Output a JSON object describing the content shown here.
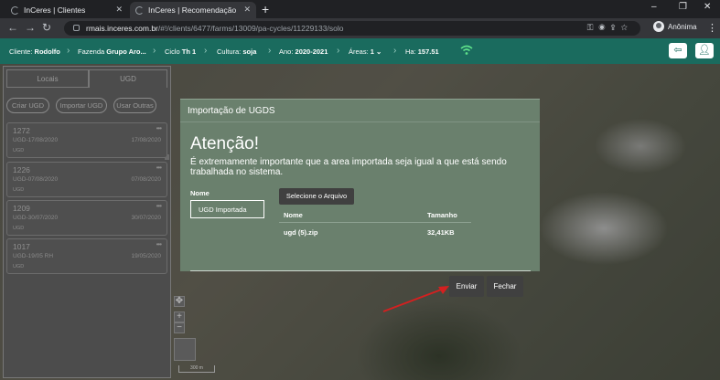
{
  "browser": {
    "tabs": [
      {
        "title": "InCeres | Clientes"
      },
      {
        "title": "InCeres | Recomendação"
      }
    ],
    "new_tab": "+",
    "url_host": "rmais.inceres.com.br",
    "url_path": "/#!/clients/6477/farms/13009/pa-cycles/11229133/solo",
    "profile_name": "Anônima"
  },
  "header": {
    "cliente_label": "Cliente:",
    "cliente_value": "Rodolfo",
    "fazenda_label": "Fazenda",
    "fazenda_value": "Grupo Aro...",
    "ciclo_label": "Ciclo",
    "ciclo_value": "Th 1",
    "cultura_label": "Cultura:",
    "cultura_value": "soja",
    "ano_label": "Ano:",
    "ano_value": "2020-2021",
    "areas_label": "Áreas:",
    "areas_value": "1",
    "ha_label": "Ha:",
    "ha_value": "157.51",
    "accent_color": "#1a6b5e"
  },
  "sidebar": {
    "tabs": [
      {
        "label": "Locais"
      },
      {
        "label": "UGD"
      }
    ],
    "buttons": [
      {
        "label": "Criar UGD"
      },
      {
        "label": "Importar UGD"
      },
      {
        "label": "Usar Outras"
      }
    ],
    "cards": [
      {
        "id": "1272",
        "name": "UGD-17/08/2020",
        "tag": "UGD",
        "date": "17/08/2020"
      },
      {
        "id": "1226",
        "name": "UGD-07/08/2020",
        "tag": "UGD",
        "date": "07/08/2020"
      },
      {
        "id": "1209",
        "name": "UGD-30/07/2020",
        "tag": "UGD",
        "date": "30/07/2020"
      },
      {
        "id": "1017",
        "name": "UGD-19/05 RH",
        "tag": "UGD",
        "date": "19/05/2020"
      }
    ]
  },
  "map": {
    "zoom_in": "+",
    "zoom_out": "−",
    "scale_label": "300 m"
  },
  "modal": {
    "title": "Importação de UGDS",
    "heading": "Atenção!",
    "message": "É extremamente importante que a area importada seja igual a que está sendo trabalhada no sistema.",
    "name_label": "Nome",
    "name_value": "UGD Importada",
    "select_file_label": "Selecione o Arquivo",
    "table_headers": {
      "name": "Nome",
      "size": "Tamanho"
    },
    "file": {
      "name": "ugd (5).zip",
      "size": "32,41KB"
    },
    "send_label": "Enviar",
    "close_label": "Fechar"
  }
}
